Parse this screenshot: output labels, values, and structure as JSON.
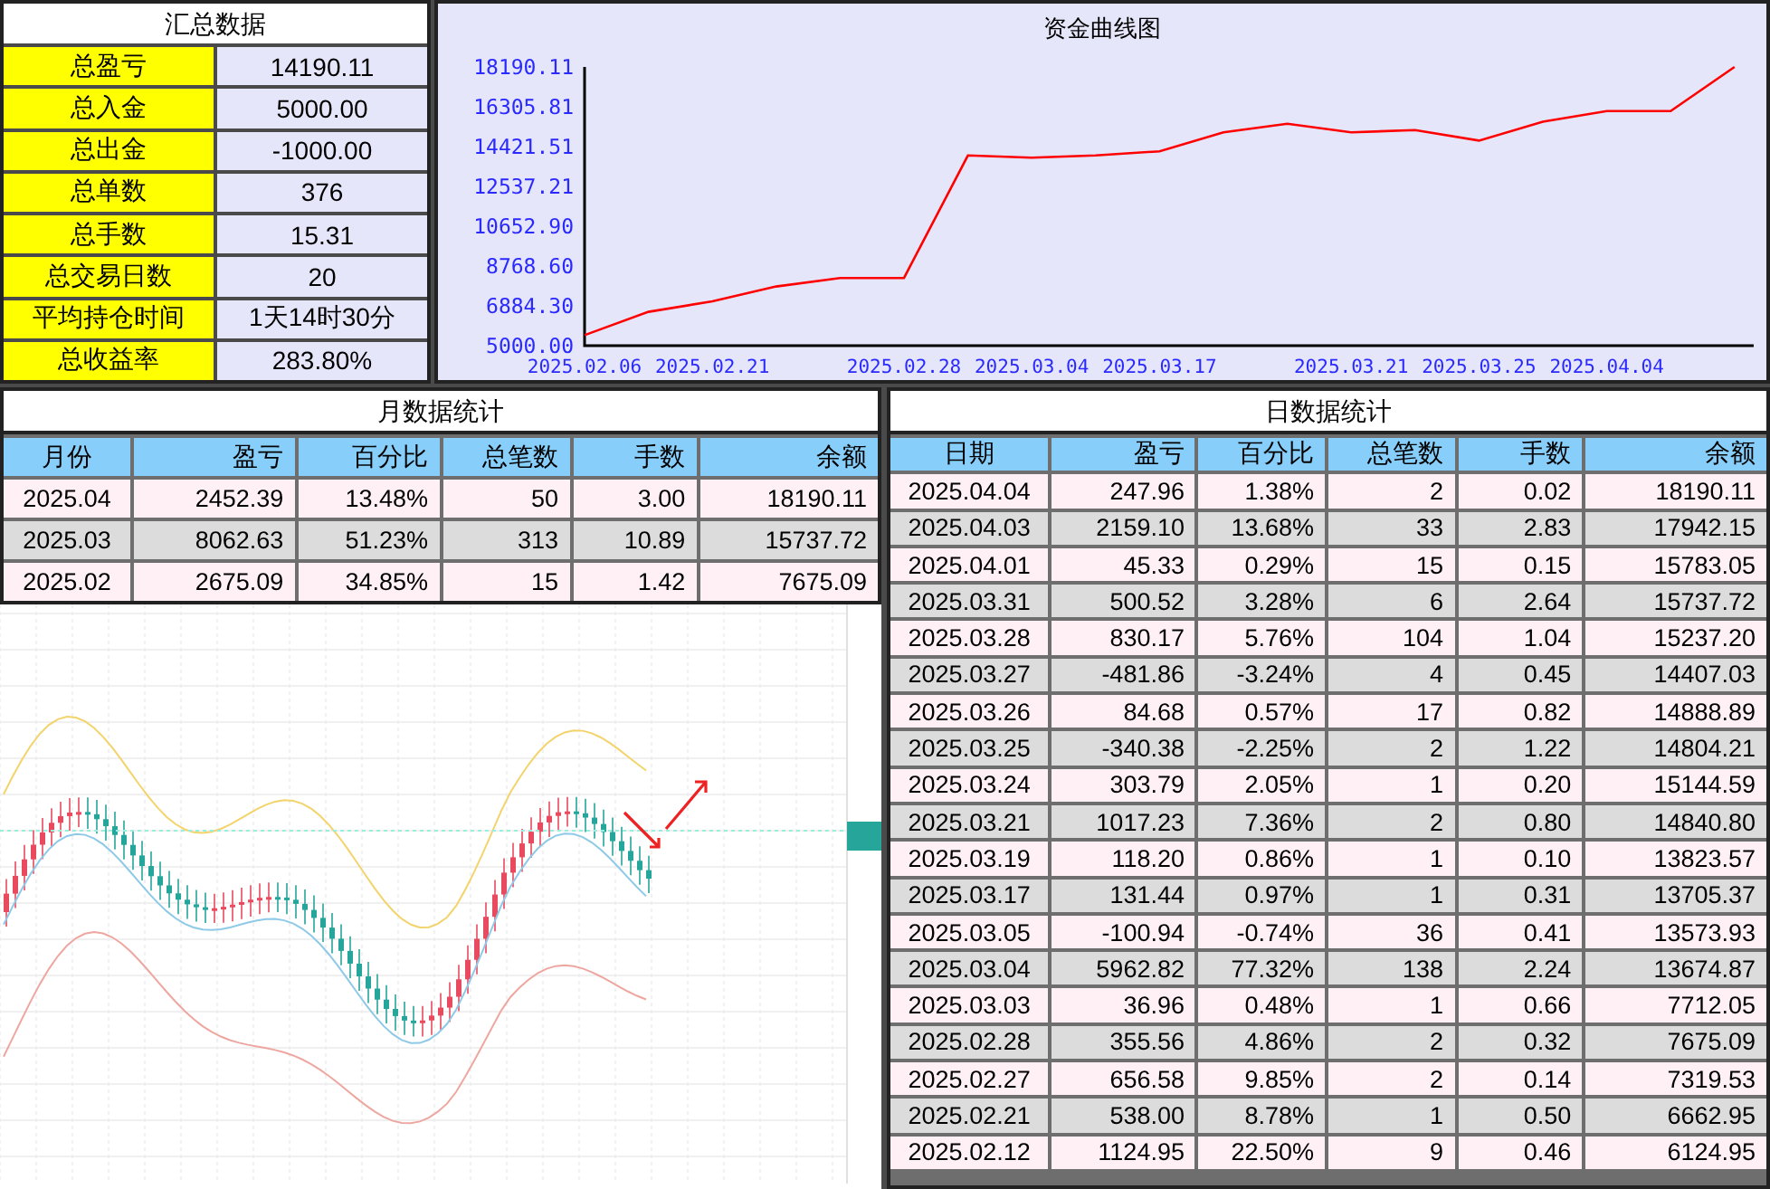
{
  "summary": {
    "title": "汇总数据",
    "rows": [
      {
        "label": "总盈亏",
        "value": "14190.11"
      },
      {
        "label": "总入金",
        "value": "5000.00"
      },
      {
        "label": "总出金",
        "value": "-1000.00"
      },
      {
        "label": "总单数",
        "value": "376"
      },
      {
        "label": "总手数",
        "value": "15.31"
      },
      {
        "label": "总交易日数",
        "value": "20"
      },
      {
        "label": "平均持仓时间",
        "value": "1天14时30分"
      },
      {
        "label": "总收益率",
        "value": "283.80%"
      }
    ]
  },
  "equity_chart": {
    "chart_data": {
      "type": "line",
      "title": "资金曲线图",
      "categories": [
        "2025.02.06",
        null,
        "2025.02.21",
        null,
        null,
        "2025.02.28",
        null,
        "2025.03.04",
        null,
        "2025.03.17",
        null,
        null,
        "2025.03.21",
        null,
        "2025.03.25",
        null,
        "2025.04.04",
        null,
        null
      ],
      "series": [
        {
          "color": "#ff0000",
          "values": [
            5500,
            6600,
            7100,
            7800,
            8200,
            8200,
            14000,
            13900,
            14000,
            14200,
            15100,
            15500,
            15100,
            15200,
            14700,
            15600,
            16100,
            16100,
            18190.11
          ]
        }
      ],
      "ylim": [
        5000,
        18190.11
      ],
      "yticks": [
        {
          "value": 5000,
          "label": "5000.00"
        },
        {
          "value": 6884.3,
          "label": "6884.30"
        },
        {
          "value": 8768.6,
          "label": "8768.60"
        },
        {
          "value": 10652.9,
          "label": "10652.90"
        },
        {
          "value": 12537.21,
          "label": "12537.21"
        },
        {
          "value": 14421.51,
          "label": "14421.51"
        },
        {
          "value": 16305.81,
          "label": "16305.81"
        },
        {
          "value": 18190.11,
          "label": "18190.11"
        }
      ]
    }
  },
  "monthly": {
    "title": "月数据统计",
    "columns": [
      "月份",
      "盈亏",
      "百分比",
      "总笔数",
      "手数",
      "余额"
    ],
    "rows": [
      [
        "2025.04",
        "2452.39",
        "13.48%",
        "50",
        "3.00",
        "18190.11"
      ],
      [
        "2025.03",
        "8062.63",
        "51.23%",
        "313",
        "10.89",
        "15737.72"
      ],
      [
        "2025.02",
        "2675.09",
        "34.85%",
        "15",
        "1.42",
        "7675.09"
      ]
    ]
  },
  "daily": {
    "title": "日数据统计",
    "columns": [
      "日期",
      "盈亏",
      "百分比",
      "总笔数",
      "手数",
      "余额"
    ],
    "rows": [
      [
        "2025.04.04",
        "247.96",
        "1.38%",
        "2",
        "0.02",
        "18190.11"
      ],
      [
        "2025.04.03",
        "2159.10",
        "13.68%",
        "33",
        "2.83",
        "17942.15"
      ],
      [
        "2025.04.01",
        "45.33",
        "0.29%",
        "15",
        "0.15",
        "15783.05"
      ],
      [
        "2025.03.31",
        "500.52",
        "3.28%",
        "6",
        "2.64",
        "15737.72"
      ],
      [
        "2025.03.28",
        "830.17",
        "5.76%",
        "104",
        "1.04",
        "15237.20"
      ],
      [
        "2025.03.27",
        "-481.86",
        "-3.24%",
        "4",
        "0.45",
        "14407.03"
      ],
      [
        "2025.03.26",
        "84.68",
        "0.57%",
        "17",
        "0.82",
        "14888.89"
      ],
      [
        "2025.03.25",
        "-340.38",
        "-2.25%",
        "2",
        "1.22",
        "14804.21"
      ],
      [
        "2025.03.24",
        "303.79",
        "2.05%",
        "1",
        "0.20",
        "15144.59"
      ],
      [
        "2025.03.21",
        "1017.23",
        "7.36%",
        "2",
        "0.80",
        "14840.80"
      ],
      [
        "2025.03.19",
        "118.20",
        "0.86%",
        "1",
        "0.10",
        "13823.57"
      ],
      [
        "2025.03.17",
        "131.44",
        "0.97%",
        "1",
        "0.31",
        "13705.37"
      ],
      [
        "2025.03.05",
        "-100.94",
        "-0.74%",
        "36",
        "0.41",
        "13573.93"
      ],
      [
        "2025.03.04",
        "5962.82",
        "77.32%",
        "138",
        "2.24",
        "13674.87"
      ],
      [
        "2025.03.03",
        "36.96",
        "0.48%",
        "1",
        "0.66",
        "7712.05"
      ],
      [
        "2025.02.28",
        "355.56",
        "4.86%",
        "2",
        "0.32",
        "7675.09"
      ],
      [
        "2025.02.27",
        "656.58",
        "9.85%",
        "2",
        "0.14",
        "7319.53"
      ],
      [
        "2025.02.21",
        "538.00",
        "8.78%",
        "1",
        "0.50",
        "6662.95"
      ],
      [
        "2025.02.12",
        "1124.95",
        "22.50%",
        "9",
        "0.46",
        "6124.95"
      ]
    ]
  }
}
